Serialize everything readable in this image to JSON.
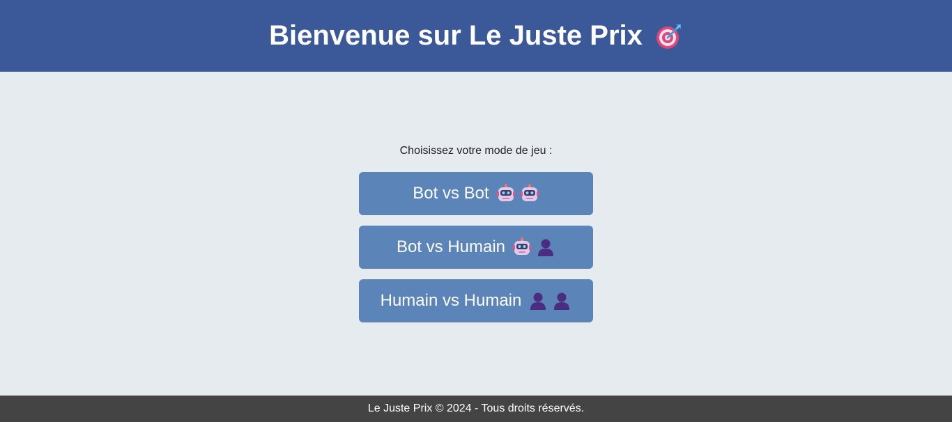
{
  "header": {
    "title": "Bienvenue sur Le Juste Prix",
    "icon": "target-icon"
  },
  "main": {
    "prompt": "Choisissez votre mode de jeu :",
    "modes": [
      {
        "label": "Bot vs Bot",
        "icons": [
          "robot-icon",
          "robot-icon"
        ]
      },
      {
        "label": "Bot vs Humain",
        "icons": [
          "robot-icon",
          "person-icon"
        ]
      },
      {
        "label": "Humain vs Humain",
        "icons": [
          "person-icon",
          "person-icon"
        ]
      }
    ]
  },
  "footer": {
    "text": "Le Juste Prix © 2024 - Tous droits réservés."
  },
  "colors": {
    "header_bg": "#3b5998",
    "page_bg": "#e6ebf0",
    "button_bg": "#5b84b8",
    "footer_bg": "#444444"
  }
}
